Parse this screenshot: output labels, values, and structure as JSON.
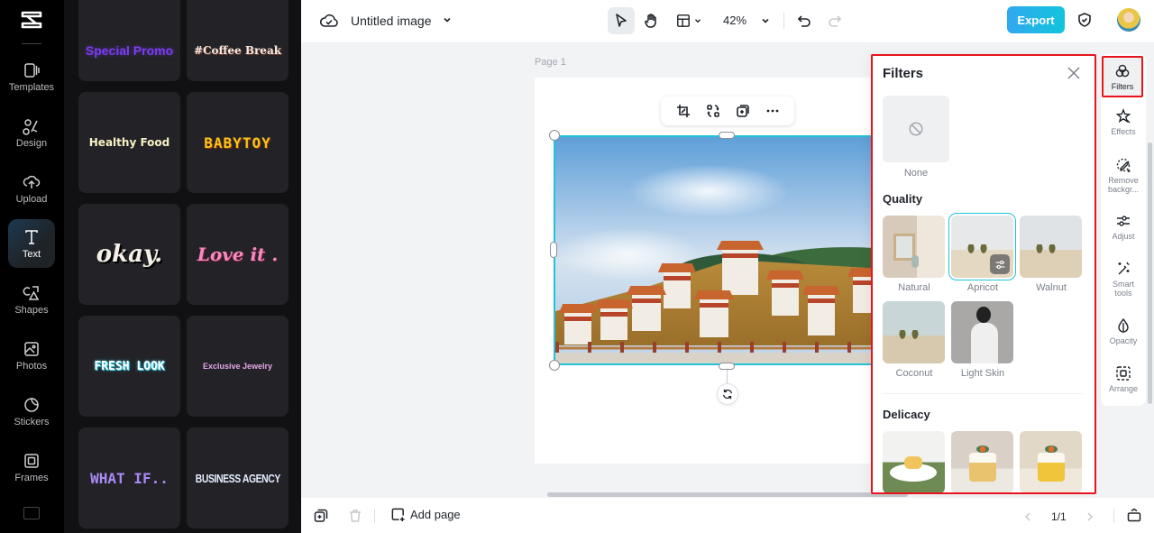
{
  "app": {
    "logo": "capcut-logo-icon"
  },
  "rail": {
    "items": [
      {
        "label": "Templates",
        "icon": "templates-icon"
      },
      {
        "label": "Design",
        "icon": "design-icon"
      },
      {
        "label": "Upload",
        "icon": "upload-cloud-icon"
      },
      {
        "label": "Text",
        "icon": "text-icon",
        "active": true
      },
      {
        "label": "Shapes",
        "icon": "shapes-icon"
      },
      {
        "label": "Photos",
        "icon": "photos-icon"
      },
      {
        "label": "Stickers",
        "icon": "stickers-icon"
      },
      {
        "label": "Frames",
        "icon": "frames-icon"
      }
    ]
  },
  "text_panel": {
    "templates": [
      {
        "label": "Special Promo",
        "color": "#7a3cf0"
      },
      {
        "label": "#Coffee Break",
        "color": "#f3ece4"
      },
      {
        "label": "Healthy Food",
        "color": "#f6f1c4"
      },
      {
        "label": "BABYTOY",
        "color": "#f5c518"
      },
      {
        "label": "okay.",
        "color": "#f5efe6"
      },
      {
        "label": "Love it .",
        "color": "#f58ac0"
      },
      {
        "label": "FRESH LOOK",
        "color": "#8fe6f5"
      },
      {
        "label": "Exclusive Jewelry",
        "color": "#e3a6e8"
      },
      {
        "label": "WHAT IF..",
        "color": "#a98af5"
      },
      {
        "label": "BUSINESS AGENCY",
        "color": "#e6ecff"
      }
    ]
  },
  "topbar": {
    "doc_title": "Untitled image",
    "zoom": "42%",
    "export_label": "Export"
  },
  "canvas": {
    "page_label": "Page 1"
  },
  "filters": {
    "title": "Filters",
    "none_label": "None",
    "sections": [
      {
        "title": "Quality",
        "items": [
          {
            "label": "Natural"
          },
          {
            "label": "Apricot",
            "selected": true
          },
          {
            "label": "Walnut"
          },
          {
            "label": "Coconut"
          },
          {
            "label": "Light Skin"
          }
        ]
      },
      {
        "title": "Delicacy",
        "items": [
          {
            "label": ""
          },
          {
            "label": ""
          },
          {
            "label": ""
          }
        ]
      }
    ]
  },
  "prop_rail": {
    "items": [
      {
        "label": "Filters",
        "active": true
      },
      {
        "label": "Effects"
      },
      {
        "label": "Remove backgr..."
      },
      {
        "label": "Adjust"
      },
      {
        "label": "Smart tools"
      },
      {
        "label": "Opacity"
      },
      {
        "label": "Arrange"
      }
    ]
  },
  "bottombar": {
    "add_page_label": "Add page",
    "page_indicator": "1/1"
  }
}
